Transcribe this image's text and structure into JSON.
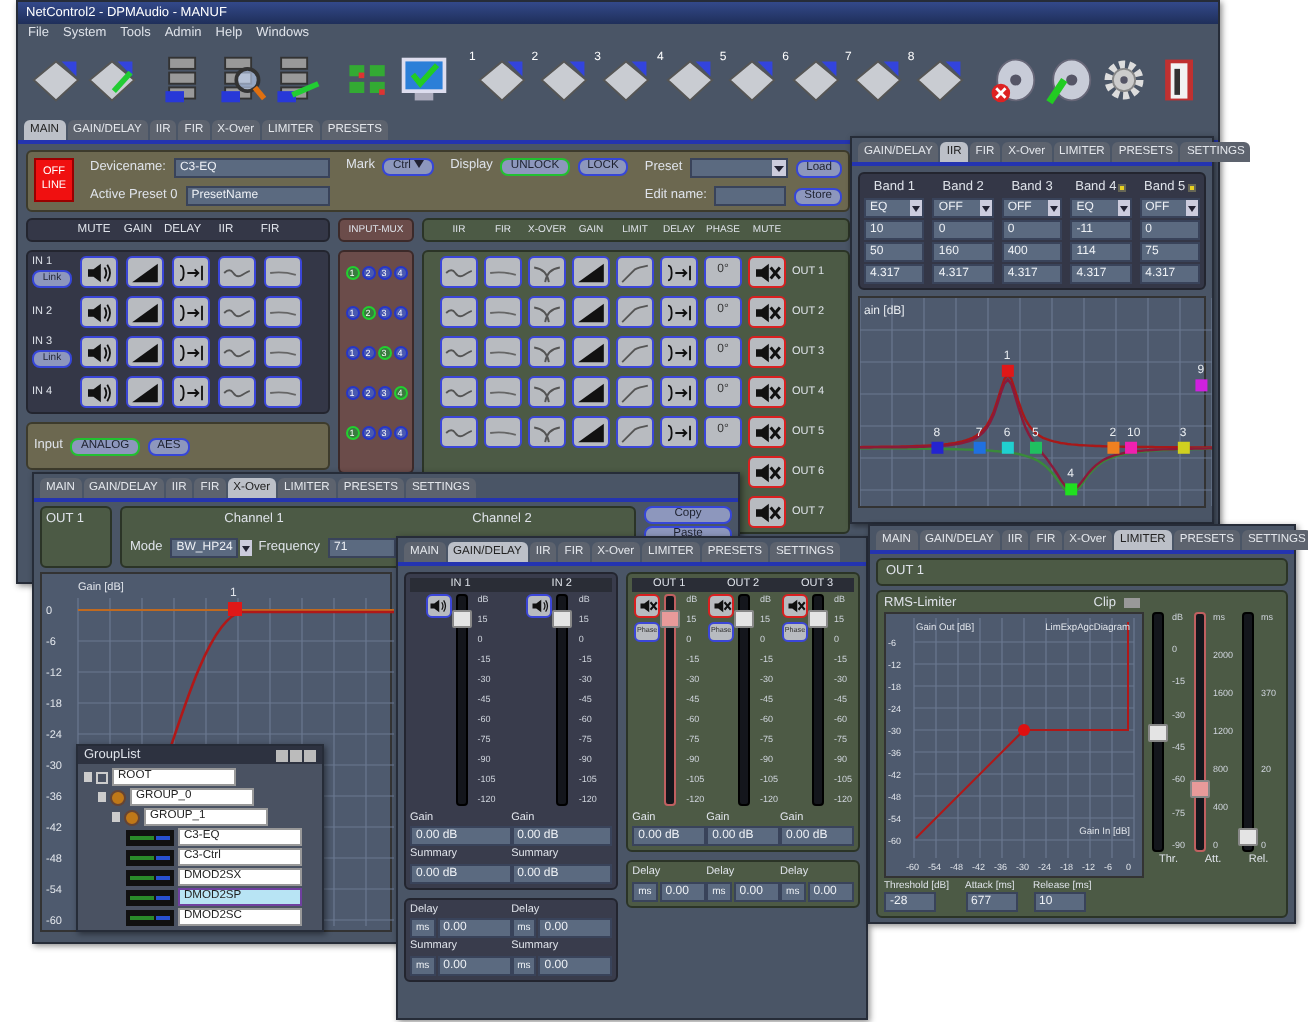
{
  "main_window": {
    "title": "NetControl2 - DPMAudio - MANUF",
    "menu": [
      "File",
      "System",
      "Tools",
      "Admin",
      "Help",
      "Windows"
    ],
    "toolbar": [
      {
        "kind": "disk"
      },
      {
        "kind": "disk-plug"
      },
      {
        "kind": "rack"
      },
      {
        "kind": "rack-search"
      },
      {
        "kind": "rack-plug"
      },
      {
        "kind": "grid"
      },
      {
        "kind": "monitor"
      },
      {
        "kind": "disk",
        "number": "1"
      },
      {
        "kind": "disk",
        "number": "2"
      },
      {
        "kind": "disk",
        "number": "3"
      },
      {
        "kind": "disk",
        "number": "4"
      },
      {
        "kind": "disk",
        "number": "5"
      },
      {
        "kind": "disk",
        "number": "6"
      },
      {
        "kind": "disk",
        "number": "7"
      },
      {
        "kind": "disk",
        "number": "8"
      },
      {
        "kind": "disc-error"
      },
      {
        "kind": "disc-plug"
      },
      {
        "kind": "gear"
      },
      {
        "kind": "exit"
      }
    ],
    "tabs": [
      {
        "label": "MAIN",
        "selected": true
      },
      {
        "label": "GAIN/DELAY",
        "selected": false
      },
      {
        "label": "IIR",
        "selected": false
      },
      {
        "label": "FIR",
        "selected": false
      },
      {
        "label": "X-Over",
        "selected": false
      },
      {
        "label": "LIMITER",
        "selected": false
      },
      {
        "label": "PRESETS",
        "selected": false
      }
    ],
    "device": {
      "status": "OFF LINE",
      "devicename_label": "Devicename:",
      "devicename": "C3-EQ",
      "active_preset_label": "Active Preset 0",
      "active_preset": "PresetName",
      "mark_label": "Mark",
      "mark": "Ctrl",
      "display_label": "Display",
      "display_options": [
        {
          "label": "UNLOCK",
          "selected": true
        },
        {
          "label": "LOCK",
          "selected": false
        }
      ],
      "preset_label": "Preset",
      "load": "Load",
      "edit_name_label": "Edit name:",
      "store": "Store"
    },
    "input_headers": [
      {
        "label": "MUTE",
        "kind": "speaker"
      },
      {
        "label": "GAIN",
        "kind": "gain"
      },
      {
        "label": "DELAY",
        "kind": "delay"
      },
      {
        "label": "IIR",
        "kind": "curve"
      },
      {
        "label": "FIR",
        "kind": "flat"
      }
    ],
    "inputs": [
      {
        "label": "IN 1",
        "link": "Link",
        "muted": false
      },
      {
        "label": "IN 2",
        "muted": false
      },
      {
        "label": "IN 3",
        "link": "Link",
        "muted": false
      },
      {
        "label": "IN 4",
        "muted": false
      }
    ],
    "input_mux": {
      "title": "INPUT-MUX",
      "rows": [
        {
          "buttons": [
            {
              "label": "1",
              "selected": true
            },
            {
              "label": "2",
              "selected": false
            },
            {
              "label": "3",
              "selected": false
            },
            {
              "label": "4",
              "selected": false
            }
          ]
        },
        {
          "buttons": [
            {
              "label": "1",
              "selected": false
            },
            {
              "label": "2",
              "selected": true
            },
            {
              "label": "3",
              "selected": false
            },
            {
              "label": "4",
              "selected": false
            }
          ]
        },
        {
          "buttons": [
            {
              "label": "1",
              "selected": false
            },
            {
              "label": "2",
              "selected": false
            },
            {
              "label": "3",
              "selected": true
            },
            {
              "label": "4",
              "selected": false
            }
          ]
        },
        {
          "buttons": [
            {
              "label": "1",
              "selected": false
            },
            {
              "label": "2",
              "selected": false
            },
            {
              "label": "3",
              "selected": false
            },
            {
              "label": "4",
              "selected": true
            }
          ]
        },
        {
          "buttons": [
            {
              "label": "1",
              "selected": true
            },
            {
              "label": "2",
              "selected": false
            },
            {
              "label": "3",
              "selected": false
            },
            {
              "label": "4",
              "selected": false
            }
          ]
        }
      ]
    },
    "output_headers": [
      {
        "label": "IIR",
        "kind": "curve"
      },
      {
        "label": "FIR",
        "kind": "flat"
      },
      {
        "label": "X-OVER",
        "kind": "xover"
      },
      {
        "label": "GAIN",
        "kind": "gain"
      },
      {
        "label": "LIMIT",
        "kind": "limit"
      },
      {
        "label": "DELAY",
        "kind": "delay"
      },
      {
        "label": "PHASE",
        "kind": "phase"
      },
      {
        "label": "MUTE",
        "kind": "mute"
      }
    ],
    "outputs": [
      {
        "label": "OUT 1",
        "kind": "full",
        "phase": "0°",
        "muted": true
      },
      {
        "label": "OUT 2",
        "kind": "full",
        "phase": "0°",
        "muted": true
      },
      {
        "label": "OUT 3",
        "kind": "full",
        "phase": "0°",
        "muted": true
      },
      {
        "label": "OUT 4",
        "kind": "full",
        "phase": "0°",
        "muted": true
      },
      {
        "label": "OUT 5",
        "kind": "full",
        "phase": "0°",
        "muted": true
      },
      {
        "label": "OUT 6",
        "kind": "partial",
        "muted": true
      },
      {
        "label": "OUT 7",
        "kind": "partial",
        "muted": true
      }
    ],
    "input_source": {
      "label": "Input",
      "options": [
        {
          "label": "ANALOG",
          "selected": true
        },
        {
          "label": "AES",
          "selected": false
        }
      ]
    }
  },
  "iir_window": {
    "tabs": [
      {
        "label": "GAIN/DELAY",
        "selected": false
      },
      {
        "label": "IIR",
        "selected": true
      },
      {
        "label": "FIR",
        "selected": false
      },
      {
        "label": "X-Over",
        "selected": false
      },
      {
        "label": "LIMITER",
        "selected": false
      },
      {
        "label": "PRESETS",
        "selected": false
      },
      {
        "label": "SETTINGS",
        "selected": false
      }
    ],
    "bands": [
      {
        "label": "Band 1",
        "flag": false,
        "type": "EQ",
        "gain": "10",
        "frequency": "50",
        "q": "4.317"
      },
      {
        "label": "Band 2",
        "flag": false,
        "type": "OFF",
        "gain": "0",
        "frequency": "160",
        "q": "4.317"
      },
      {
        "label": "Band 3",
        "flag": false,
        "type": "OFF",
        "gain": "0",
        "frequency": "400",
        "q": "4.317"
      },
      {
        "label": "Band 4",
        "flag": true,
        "type": "EQ",
        "gain": "-11",
        "frequency": "114",
        "q": "4.317"
      },
      {
        "label": "Band 5",
        "flag": true,
        "type": "OFF",
        "gain": "0",
        "frequency": "75",
        "q": "4.317"
      }
    ],
    "chart": {
      "title": "ain [dB]",
      "points": [
        {
          "label": "1",
          "color": "#e01818"
        },
        {
          "label": "9",
          "color": "#d020e0"
        },
        {
          "label": "8",
          "color": "#2424d0"
        },
        {
          "label": "7",
          "color": "#2070e0"
        },
        {
          "label": "6",
          "color": "#20d0d0"
        },
        {
          "label": "5",
          "color": "#20c060"
        },
        {
          "label": "2",
          "color": "#f08020"
        },
        {
          "label": "10",
          "color": "#f020b0"
        },
        {
          "label": "3",
          "color": "#d0d020"
        },
        {
          "label": "4",
          "color": "#20e020"
        }
      ]
    }
  },
  "xover_window": {
    "tabs": [
      {
        "label": "MAIN",
        "selected": false
      },
      {
        "label": "GAIN/DELAY",
        "selected": false
      },
      {
        "label": "IIR",
        "selected": false
      },
      {
        "label": "FIR",
        "selected": false
      },
      {
        "label": "X-Over",
        "selected": true
      },
      {
        "label": "LIMITER",
        "selected": false
      },
      {
        "label": "PRESETS",
        "selected": false
      },
      {
        "label": "SETTINGS",
        "selected": false
      }
    ],
    "output": "OUT 1",
    "channels": [
      "Channel 1",
      "Channel 2"
    ],
    "mode_label": "Mode",
    "mode": "BW_HP24",
    "frequency_label": "Frequency",
    "frequency": "71",
    "buttons": [
      "Copy",
      "Paste"
    ],
    "chart": {
      "title": "Gain [dB]",
      "point": "1",
      "y_labels": [
        "0",
        "-6",
        "-12",
        "-18",
        "-24",
        "-30",
        "-36",
        "-42",
        "-48",
        "-54",
        "-60"
      ]
    }
  },
  "group_list": {
    "title": "GroupList",
    "tree": [
      {
        "label": "ROOT",
        "kind": "root",
        "selected": false,
        "children": [
          {
            "label": "GROUP_0",
            "kind": "group",
            "selected": false,
            "children": [
              {
                "label": "GROUP_1",
                "kind": "group",
                "selected": false,
                "children": [
                  {
                    "label": "C3-EQ",
                    "kind": "device",
                    "selected": false
                  },
                  {
                    "label": "C3-Ctrl",
                    "kind": "device",
                    "selected": false
                  },
                  {
                    "label": "DMOD2SX",
                    "kind": "device",
                    "selected": false
                  },
                  {
                    "label": "DMOD2SP",
                    "kind": "device",
                    "selected": true
                  },
                  {
                    "label": "DMOD2SC",
                    "kind": "device",
                    "selected": false
                  }
                ]
              }
            ]
          }
        ]
      }
    ]
  },
  "gain_window": {
    "tabs": [
      {
        "label": "MAIN",
        "selected": false
      },
      {
        "label": "GAIN/DELAY",
        "selected": true
      },
      {
        "label": "IIR",
        "selected": false
      },
      {
        "label": "FIR",
        "selected": false
      },
      {
        "label": "X-Over",
        "selected": false
      },
      {
        "label": "LIMITER",
        "selected": false
      },
      {
        "label": "PRESETS",
        "selected": false
      },
      {
        "label": "SETTINGS",
        "selected": false
      }
    ],
    "strips": [
      {
        "label": "IN 1",
        "kind": "input",
        "muted": false,
        "level": 0.89,
        "selected": false,
        "scale": [
          "dB",
          "15",
          "0",
          "-15",
          "-30",
          "-45",
          "-60",
          "-75",
          "-90",
          "-105",
          "-120"
        ],
        "gain_label": "Gain",
        "gain": "0.00 dB",
        "summary_label": "Summary",
        "summary": "0.00 dB",
        "delay": {
          "label": "Delay",
          "unit": "ms",
          "value": "0.00",
          "summary_label": "Summary",
          "summary_unit": "ms",
          "summary_value": "0.00"
        }
      },
      {
        "label": "IN 2",
        "kind": "input",
        "muted": false,
        "level": 0.89,
        "selected": false,
        "scale": [
          "dB",
          "15",
          "0",
          "-15",
          "-30",
          "-45",
          "-60",
          "-75",
          "-90",
          "-105",
          "-120"
        ],
        "gain_label": "Gain",
        "gain": "0.00 dB",
        "summary_label": "Summary",
        "summary": "0.00 dB",
        "delay": {
          "label": "Delay",
          "unit": "ms",
          "value": "0.00",
          "summary_label": "Summary",
          "summary_unit": "ms",
          "summary_value": "0.00"
        }
      },
      {
        "label": "OUT 1",
        "kind": "output",
        "muted": true,
        "phase": "Phase",
        "level": 0.89,
        "selected": true,
        "scale": [
          "dB",
          "15",
          "0",
          "-15",
          "-30",
          "-45",
          "-60",
          "-75",
          "-90",
          "-105",
          "-120"
        ],
        "gain_label": "Gain",
        "gain": "0.00 dB",
        "delay": {
          "label": "Delay",
          "unit": "ms",
          "value": "0.00"
        }
      },
      {
        "label": "OUT 2",
        "kind": "output",
        "muted": true,
        "phase": "Phase",
        "level": 0.89,
        "selected": false,
        "scale": [
          "dB",
          "15",
          "0",
          "-15",
          "-30",
          "-45",
          "-60",
          "-75",
          "-90",
          "-105",
          "-120"
        ],
        "gain_label": "Gain",
        "gain": "0.00 dB",
        "delay": {
          "label": "Delay",
          "unit": "ms",
          "value": "0.00"
        }
      },
      {
        "label": "OUT 3",
        "kind": "output",
        "muted": true,
        "phase": "Phase",
        "level": 0.89,
        "selected": false,
        "scale": [
          "dB",
          "15",
          "0",
          "-15",
          "-30",
          "-45",
          "-60",
          "-75",
          "-90",
          "-105",
          "-120"
        ],
        "gain_label": "Gain",
        "gain": "0.00 dB",
        "delay": {
          "label": "Delay",
          "unit": "ms",
          "value": "0.00"
        }
      }
    ]
  },
  "limiter_window": {
    "tabs": [
      {
        "label": "MAIN",
        "selected": false
      },
      {
        "label": "GAIN/DELAY",
        "selected": false
      },
      {
        "label": "IIR",
        "selected": false
      },
      {
        "label": "FIR",
        "selected": false
      },
      {
        "label": "X-Over",
        "selected": false
      },
      {
        "label": "LIMITER",
        "selected": true
      },
      {
        "label": "PRESETS",
        "selected": false
      },
      {
        "label": "SETTINGS",
        "selected": false
      }
    ],
    "output": "OUT 1",
    "title": "RMS-Limiter",
    "clip": "Clip",
    "chart": {
      "ylabel": "Gain Out [dB]",
      "title": "LimExpAgcDiagram",
      "xlabel": "Gain In [dB]",
      "y_labels": [
        "-6",
        "-12",
        "-18",
        "-24",
        "-30",
        "-36",
        "-42",
        "-48",
        "-54",
        "-60"
      ],
      "x_labels": [
        "-60",
        "-54",
        "-48",
        "-42",
        "-36",
        "-30",
        "-24",
        "-18",
        "-12",
        "-6",
        "0"
      ]
    },
    "faders": [
      {
        "label": "Thr.",
        "level": 0.5,
        "selected": false,
        "scale": [
          "dB",
          "0",
          "-15",
          "-30",
          "-45",
          "-60",
          "-75",
          "-90"
        ]
      },
      {
        "label": "Att.",
        "level": 0.27,
        "selected": true,
        "scale": [
          "ms",
          "2000",
          "1600",
          "1200",
          "800",
          "400",
          "0"
        ]
      },
      {
        "label": "Rel.",
        "level": 0.07,
        "selected": false,
        "scale": [
          "ms",
          "370",
          "20",
          "0"
        ]
      }
    ],
    "fields": [
      {
        "label": "Threshold [dB]",
        "value": "-28"
      },
      {
        "label": "Attack [ms]",
        "value": "677"
      },
      {
        "label": "Release [ms]",
        "value": "10"
      }
    ]
  }
}
